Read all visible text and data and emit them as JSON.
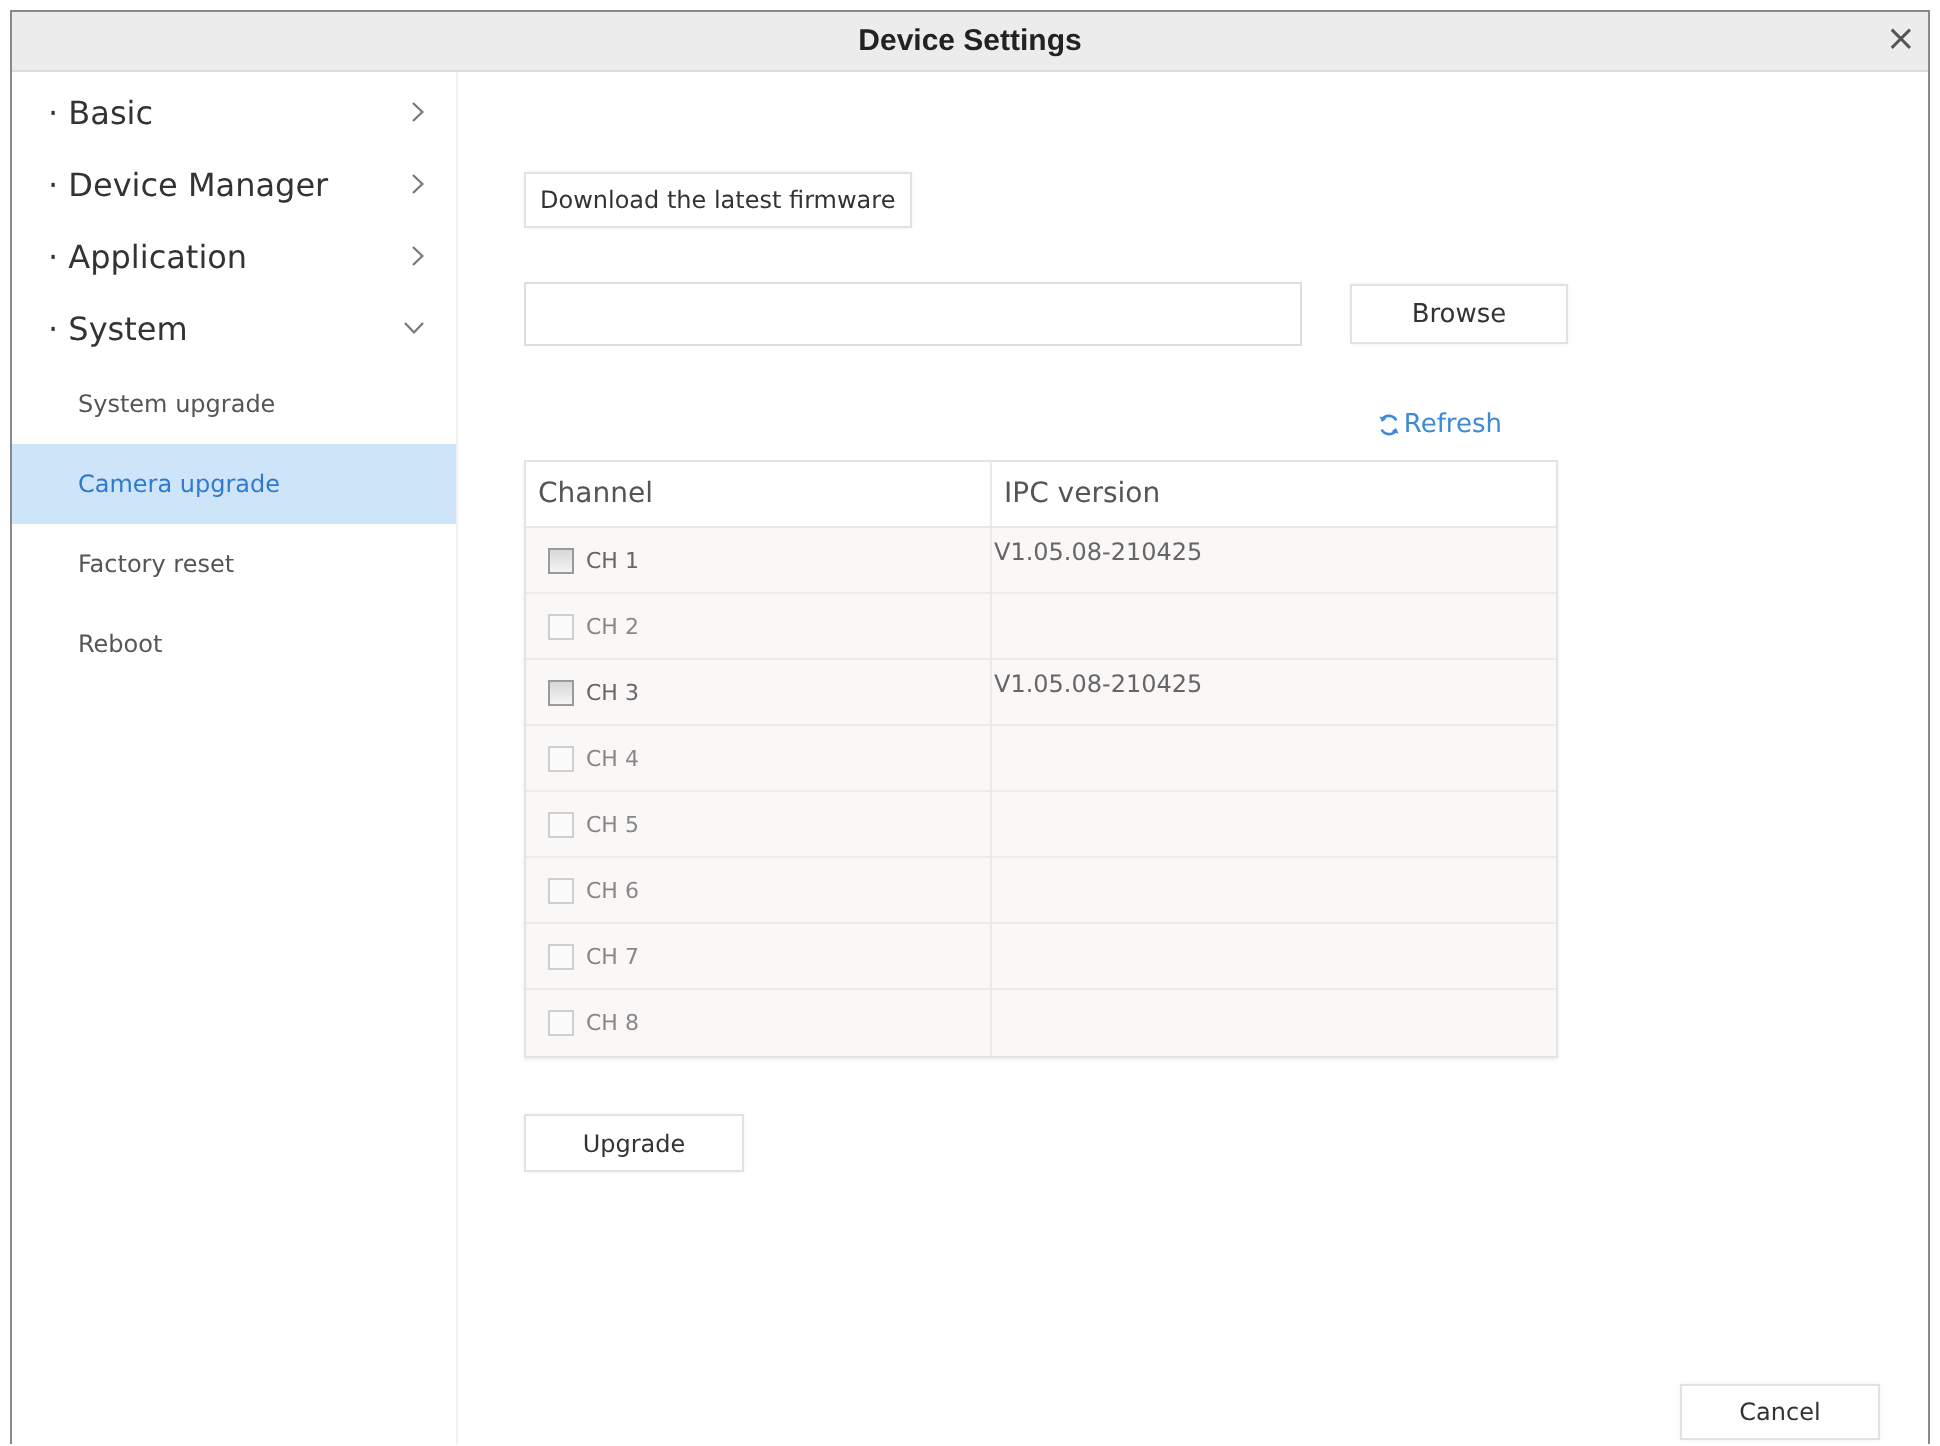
{
  "window": {
    "title": "Device Settings",
    "close": "×"
  },
  "sidebar": {
    "items": [
      {
        "label": "· Basic",
        "expanded": false
      },
      {
        "label": "· Device Manager",
        "expanded": false
      },
      {
        "label": "· Application",
        "expanded": false
      },
      {
        "label": "· System",
        "expanded": true,
        "children": [
          {
            "label": "System upgrade",
            "selected": false
          },
          {
            "label": "Camera upgrade",
            "selected": true
          },
          {
            "label": "Factory reset",
            "selected": false
          },
          {
            "label": "Reboot",
            "selected": false
          }
        ]
      }
    ]
  },
  "content": {
    "download_button": "Download the latest firmware",
    "browse_button": "Browse",
    "refresh_link": "Refresh",
    "table": {
      "columns": [
        "Channel",
        "IPC version"
      ],
      "rows": [
        {
          "channel": "CH 1",
          "checked": false,
          "disabled": false,
          "version": "V1.05.08-210425"
        },
        {
          "channel": "CH 2",
          "checked": false,
          "disabled": true
        },
        {
          "channel": "CH 3",
          "checked": false,
          "disabled": false,
          "version": "V1.05.08-210425"
        },
        {
          "channel": "CH 4",
          "checked": false,
          "disabled": true
        },
        {
          "channel": "CH 5",
          "checked": false,
          "disabled": true
        },
        {
          "channel": "CH 6",
          "checked": false,
          "disabled": true
        },
        {
          "channel": "CH 7",
          "checked": false,
          "disabled": true
        },
        {
          "channel": "CH 8",
          "checked": false,
          "disabled": true
        }
      ]
    },
    "upgrade_button": "Upgrade"
  },
  "footer": {
    "cancel_button": "Cancel"
  }
}
